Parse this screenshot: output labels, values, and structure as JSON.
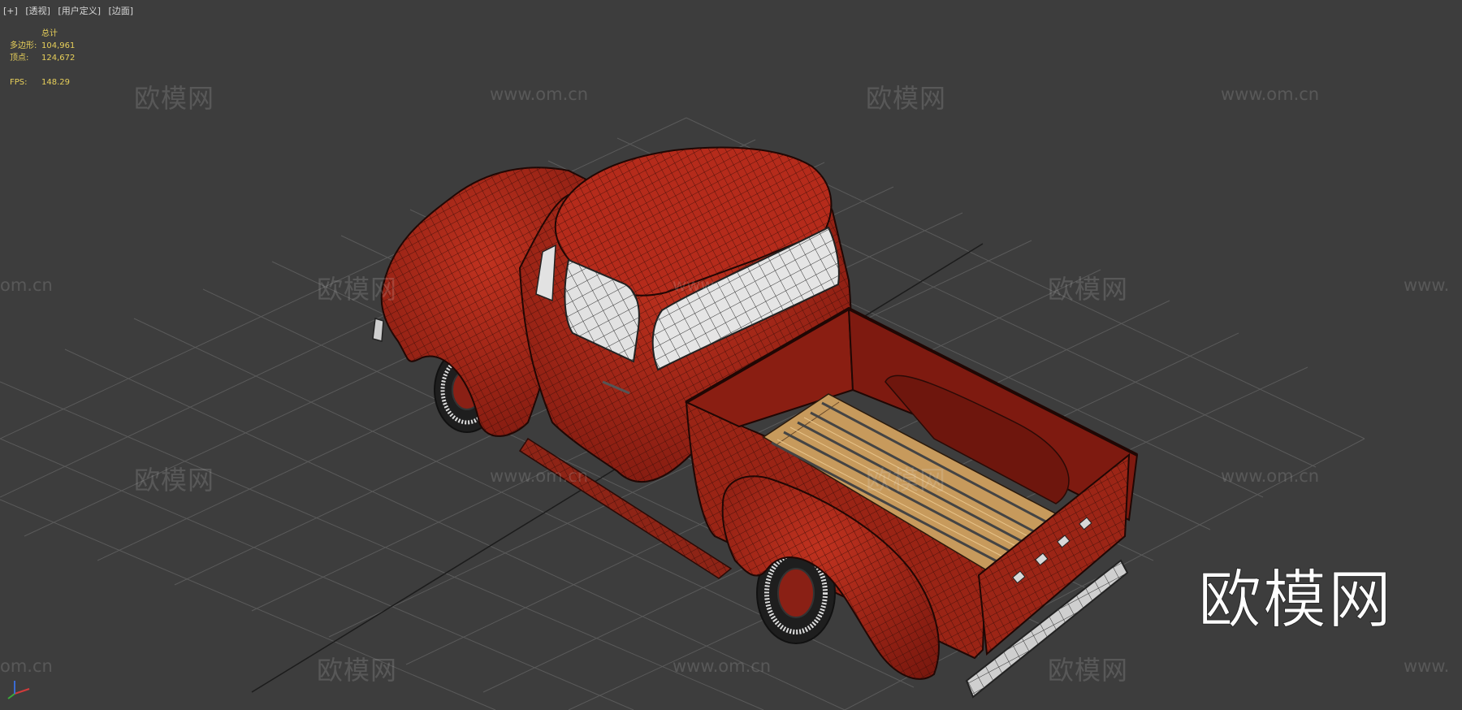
{
  "viewport": {
    "menu": [
      "[+]",
      "[透视]",
      "[用户定义]",
      "[边面]"
    ],
    "stats": {
      "header": "总计",
      "polygons_label": "多边形:",
      "polygons_value": "104,961",
      "vertices_label": "顶点:",
      "vertices_value": "124,672",
      "fps_label": "FPS:",
      "fps_value": "148.29"
    },
    "background_color": "#3d3d3d",
    "model": {
      "name_icon": "pickup-truck-wireframe",
      "body_color": "#a8261a",
      "bed_wood_color": "#c79a5c",
      "glass_color": "#e0e0e0"
    },
    "axis_gizmo_icon": "xyz-axis-icon"
  },
  "watermarks": {
    "brand_cn": "欧模网",
    "url": "www.om.cn",
    "url_partial_left": "om.cn",
    "url_partial_right": "www.",
    "big_logo": "欧模网"
  }
}
